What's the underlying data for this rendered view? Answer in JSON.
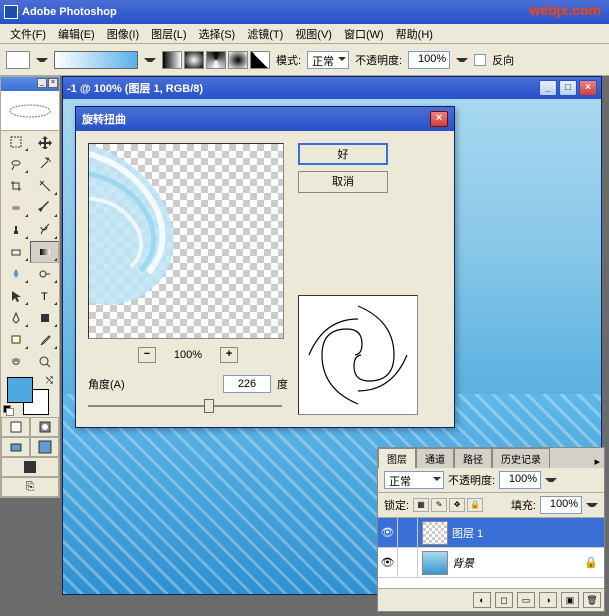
{
  "watermark": "webjx.com",
  "app": {
    "title": "Adobe Photoshop"
  },
  "menu": {
    "file": "文件(F)",
    "edit": "编辑(E)",
    "image": "图像(I)",
    "layer": "图层(L)",
    "select": "选择(S)",
    "filter": "滤镜(T)",
    "view": "视图(V)",
    "window": "窗口(W)",
    "help": "帮助(H)"
  },
  "optbar": {
    "mode_label": "模式:",
    "mode_value": "正常",
    "opacity_label": "不透明度:",
    "opacity_value": "100%",
    "reverse": "反向"
  },
  "doc": {
    "title": "-1 @ 100% (图层 1, RGB/8)"
  },
  "dialog": {
    "title": "旋转扭曲",
    "ok": "好",
    "cancel": "取消",
    "zoom": "100%",
    "angle_label": "角度(A)",
    "angle_value": "226",
    "degree": "度"
  },
  "layers": {
    "tabs": {
      "layers": "图层",
      "channels": "通道",
      "paths": "路径",
      "history": "历史记录"
    },
    "blend": "正常",
    "opacity_label": "不透明度:",
    "opacity_value": "100%",
    "lock_label": "锁定:",
    "fill_label": "填充:",
    "fill_value": "100%",
    "items": [
      {
        "name": "图层 1"
      },
      {
        "name": "背景"
      }
    ]
  },
  "colors": {
    "fg": "#4fa8e0",
    "bg": "#ffffff"
  }
}
